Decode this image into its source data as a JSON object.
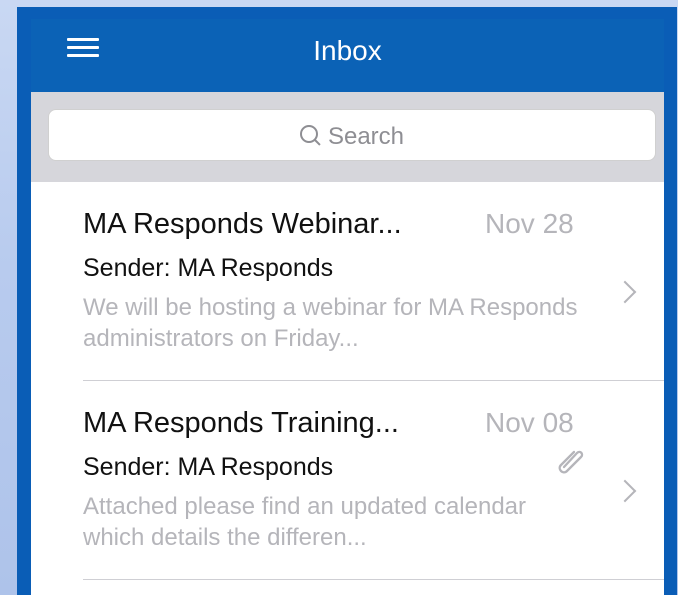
{
  "header": {
    "title": "Inbox",
    "menu_icon": "hamburger-menu-icon"
  },
  "search": {
    "placeholder": "Search",
    "icon": "search-icon"
  },
  "messages": [
    {
      "subject": "MA Responds Webinar...",
      "date": "Nov 28",
      "sender": "Sender: MA Responds",
      "preview": "We will be hosting a webinar for MA Responds administrators on Friday...",
      "has_attachment": false
    },
    {
      "subject": "MA Responds Training...",
      "date": "Nov 08",
      "sender": "Sender: MA Responds",
      "preview": "Attached please find an updated calendar which details the differen...",
      "has_attachment": true
    }
  ],
  "colors": {
    "header_blue": "#0b62b6",
    "frame_blue": "#0a5db6",
    "search_bar_gray": "#d6d6db",
    "muted_text": "#b5b5ba"
  }
}
